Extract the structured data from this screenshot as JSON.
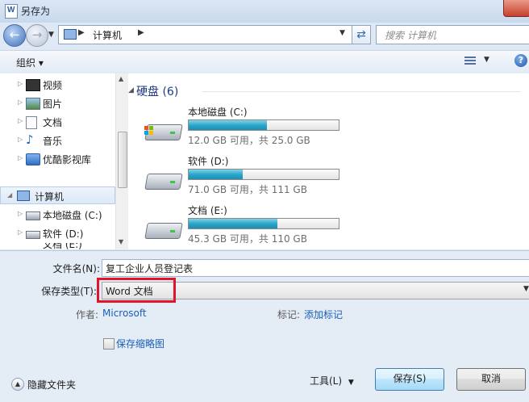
{
  "window": {
    "title": "另存为"
  },
  "address": {
    "location": "计算机",
    "search_placeholder": "搜索 计算机"
  },
  "toolbar": {
    "organize_label": "组织 ▾",
    "help_label": "?"
  },
  "nav_pane": {
    "items": [
      {
        "label": "视频",
        "icon": "video-library-icon"
      },
      {
        "label": "图片",
        "icon": "pictures-library-icon"
      },
      {
        "label": "文档",
        "icon": "documents-library-icon"
      },
      {
        "label": "音乐",
        "icon": "music-library-icon"
      },
      {
        "label": "优酷影视库",
        "icon": "youku-library-icon"
      },
      {
        "label": "计算机",
        "icon": "computer-icon",
        "selected": true
      },
      {
        "label": "本地磁盘 (C:)",
        "icon": "system-drive-icon"
      },
      {
        "label": "软件 (D:)",
        "icon": "drive-icon"
      },
      {
        "label": "文档 (E:)",
        "icon": "drive-icon"
      }
    ]
  },
  "main": {
    "group_title": "硬盘 (6)",
    "drives": [
      {
        "name": "本地磁盘 (C:)",
        "info": "12.0 GB 可用，共 25.0 GB",
        "used_fraction": 0.52,
        "system": true
      },
      {
        "name": "软件 (D:)",
        "info": "71.0 GB 可用，共 111 GB",
        "used_fraction": 0.36
      },
      {
        "name": "文档 (E:)",
        "info": "45.3 GB 可用，共 110 GB",
        "used_fraction": 0.59
      }
    ]
  },
  "form": {
    "filename_label": "文件名(N):",
    "filename_value": "复工企业人员登记表",
    "filetype_label": "保存类型(T):",
    "filetype_value": "Word 文档",
    "author_label": "作者:",
    "author_value": "Microsoft",
    "tags_label": "标记:",
    "tags_value": "添加标记",
    "thumbnail_label": "保存缩略图",
    "hide_folders_label": "隐藏文件夹",
    "tools_label": "工具(L)",
    "save_label": "保存(S)",
    "cancel_label": "取消"
  },
  "colors": {
    "highlight_box": "#e0142b",
    "usage_bar": "#27a3c6",
    "link": "#1b5fb8"
  }
}
